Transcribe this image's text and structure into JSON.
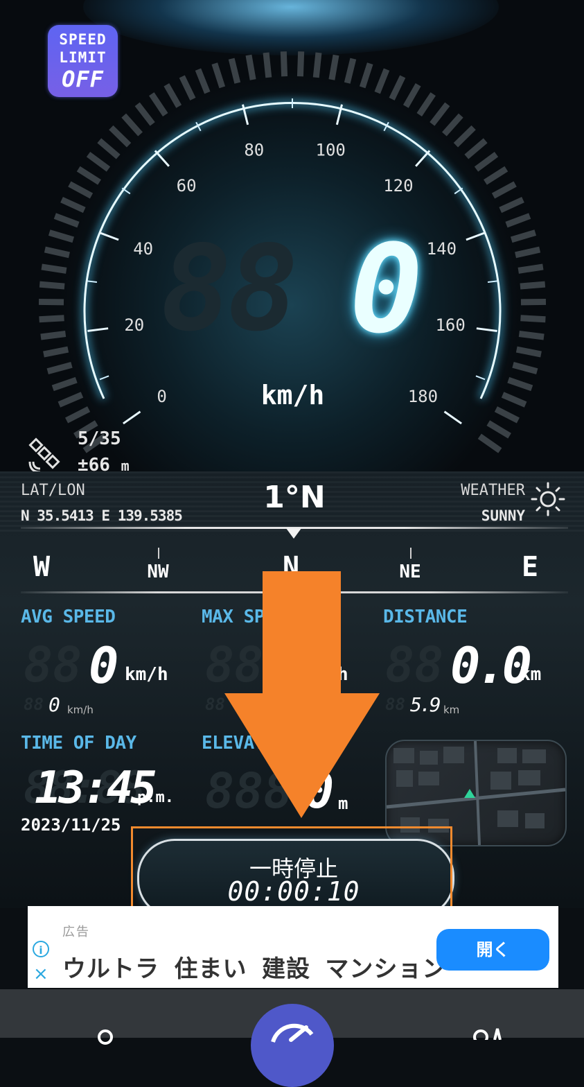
{
  "speed_limit": {
    "line1": "SPEED",
    "line2": "LIMIT",
    "state": "OFF"
  },
  "gauge": {
    "ticks": [
      "0",
      "20",
      "40",
      "60",
      "80",
      "100",
      "120",
      "140",
      "160",
      "180"
    ],
    "ghost_digits": "88",
    "current_speed": "0",
    "unit": "km/h"
  },
  "satellites": {
    "count": "5/35",
    "accuracy": "±66",
    "accuracy_unit": "m"
  },
  "location": {
    "label": "LAT/LON",
    "value": "N 35.5413  E 139.5385"
  },
  "heading": "1°N",
  "weather": {
    "label": "WEATHER",
    "value": "SUNNY",
    "icon": "sun-icon"
  },
  "compass": [
    "W",
    "NW",
    "N",
    "NE",
    "E"
  ],
  "stats": {
    "avg_speed": {
      "label": "AVG SPEED",
      "value": "0",
      "unit": "km/h",
      "sub_value": "0",
      "sub_unit": "km/h"
    },
    "max_speed": {
      "label": "MAX SPEED",
      "unit": "km/h"
    },
    "distance": {
      "label": "DISTANCE",
      "value": "0.0",
      "unit": "km",
      "sub_value": "5.9",
      "sub_unit": "km"
    },
    "time_of_day": {
      "label": "TIME OF DAY",
      "value": "13:45",
      "suffix": "p.m.",
      "date": "2023/11/25"
    },
    "elevation": {
      "label": "ELEVATION",
      "value": "0",
      "unit": "m"
    }
  },
  "pause_button": {
    "label": "一時停止",
    "timer": "00:00:10"
  },
  "ad": {
    "line1": "広告",
    "line2": "ウルトラ 住まい  建設    マンション",
    "button": "開く"
  },
  "colors": {
    "accent": "#5ab8e8",
    "highlight": "#f28a2e",
    "arrow": "#f5822a"
  }
}
